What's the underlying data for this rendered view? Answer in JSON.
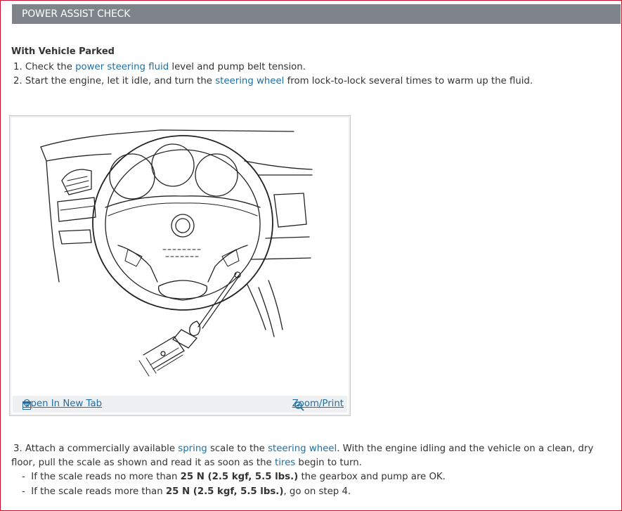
{
  "header": {
    "title": "POWER ASSIST CHECK"
  },
  "section": {
    "subtitle": "With Vehicle Parked"
  },
  "steps": {
    "step1": {
      "num": "1.",
      "pre": "Check the",
      "link": "power steering fluid",
      "post": "level and pump belt tension."
    },
    "step2": {
      "num": "2.",
      "pre": "Start the engine, let it idle, and turn the",
      "link": "steering wheel",
      "post": "from lock-to-lock several times to warm up the fluid."
    },
    "step3": {
      "num": "3.",
      "pre": "Attach a commercially available",
      "link1": "spring",
      "mid1": "scale to the",
      "link2": "steering wheel",
      "mid2": ". With the engine idling and the vehicle on a clean, dry floor, pull the scale as shown and read it as soon as the",
      "link3": "tires",
      "post": "begin to turn."
    }
  },
  "bullets": {
    "b1": {
      "dash": "-",
      "pre": "If the scale reads no more than",
      "bold": "25 N (2.5 kgf, 5.5 lbs.)",
      "post": "the gearbox and pump are OK."
    },
    "b2": {
      "dash": "-",
      "pre": "If the scale reads more than",
      "bold": "25 N (2.5 kgf, 5.5 lbs.)",
      "post": ", go on step 4."
    }
  },
  "figure": {
    "open_label": "Open In New Tab",
    "zoom_label": "Zoom/Print",
    "icons": [
      "open-new-tab-icon",
      "zoom-icon"
    ]
  },
  "colors": {
    "header_bg": "#7e8489",
    "link": "#1f6fa5",
    "border": "#c8102e"
  }
}
